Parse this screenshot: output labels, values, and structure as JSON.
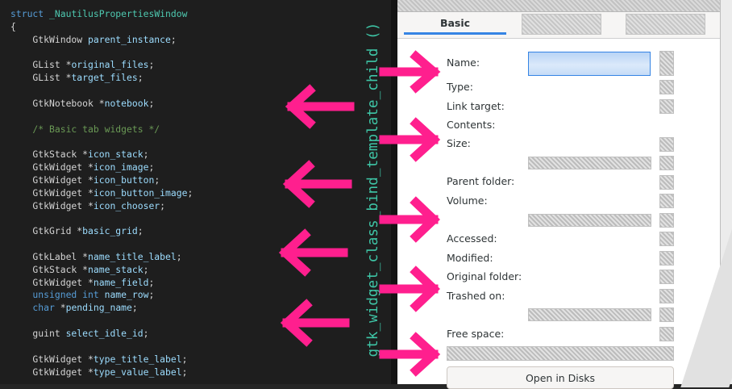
{
  "code": {
    "lines": [
      {
        "parts": [
          {
            "t": "struct ",
            "c": "kw"
          },
          {
            "t": "_NautilusPropertiesWindow",
            "c": "str"
          }
        ]
      },
      {
        "parts": [
          {
            "t": "{",
            "c": "ty"
          }
        ]
      },
      {
        "parts": [
          {
            "t": "    GtkWindow ",
            "c": "ty"
          },
          {
            "t": "parent_instance",
            "c": "id"
          },
          {
            "t": ";",
            "c": "ty"
          }
        ]
      },
      {
        "parts": []
      },
      {
        "parts": [
          {
            "t": "    GList *",
            "c": "ty"
          },
          {
            "t": "original_files",
            "c": "id"
          },
          {
            "t": ";",
            "c": "ty"
          }
        ]
      },
      {
        "parts": [
          {
            "t": "    GList *",
            "c": "ty"
          },
          {
            "t": "target_files",
            "c": "id"
          },
          {
            "t": ";",
            "c": "ty"
          }
        ]
      },
      {
        "parts": []
      },
      {
        "parts": [
          {
            "t": "    GtkNotebook *",
            "c": "ty"
          },
          {
            "t": "notebook",
            "c": "id"
          },
          {
            "t": ";",
            "c": "ty"
          }
        ]
      },
      {
        "parts": []
      },
      {
        "parts": [
          {
            "t": "    /* Basic tab widgets */",
            "c": "cm"
          }
        ]
      },
      {
        "parts": []
      },
      {
        "parts": [
          {
            "t": "    GtkStack *",
            "c": "ty"
          },
          {
            "t": "icon_stack",
            "c": "id"
          },
          {
            "t": ";",
            "c": "ty"
          }
        ]
      },
      {
        "parts": [
          {
            "t": "    GtkWidget *",
            "c": "ty"
          },
          {
            "t": "icon_image",
            "c": "id"
          },
          {
            "t": ";",
            "c": "ty"
          }
        ]
      },
      {
        "parts": [
          {
            "t": "    GtkWidget *",
            "c": "ty"
          },
          {
            "t": "icon_button",
            "c": "id"
          },
          {
            "t": ";",
            "c": "ty"
          }
        ]
      },
      {
        "parts": [
          {
            "t": "    GtkWidget *",
            "c": "ty"
          },
          {
            "t": "icon_button_image",
            "c": "id"
          },
          {
            "t": ";",
            "c": "ty"
          }
        ]
      },
      {
        "parts": [
          {
            "t": "    GtkWidget *",
            "c": "ty"
          },
          {
            "t": "icon_chooser",
            "c": "id"
          },
          {
            "t": ";",
            "c": "ty"
          }
        ]
      },
      {
        "parts": []
      },
      {
        "parts": [
          {
            "t": "    GtkGrid *",
            "c": "ty"
          },
          {
            "t": "basic_grid",
            "c": "id"
          },
          {
            "t": ";",
            "c": "ty"
          }
        ]
      },
      {
        "parts": []
      },
      {
        "parts": [
          {
            "t": "    GtkLabel *",
            "c": "ty"
          },
          {
            "t": "name_title_label",
            "c": "id"
          },
          {
            "t": ";",
            "c": "ty"
          }
        ]
      },
      {
        "parts": [
          {
            "t": "    GtkStack *",
            "c": "ty"
          },
          {
            "t": "name_stack",
            "c": "id"
          },
          {
            "t": ";",
            "c": "ty"
          }
        ]
      },
      {
        "parts": [
          {
            "t": "    GtkWidget *",
            "c": "ty"
          },
          {
            "t": "name_field",
            "c": "id"
          },
          {
            "t": ";",
            "c": "ty"
          }
        ]
      },
      {
        "parts": [
          {
            "t": "    unsigned int ",
            "c": "kw"
          },
          {
            "t": "name_row",
            "c": "id"
          },
          {
            "t": ";",
            "c": "ty"
          }
        ]
      },
      {
        "parts": [
          {
            "t": "    char ",
            "c": "kw"
          },
          {
            "t": "*",
            "c": "ty"
          },
          {
            "t": "pending_name",
            "c": "id"
          },
          {
            "t": ";",
            "c": "ty"
          }
        ]
      },
      {
        "parts": []
      },
      {
        "parts": [
          {
            "t": "    guint ",
            "c": "ty"
          },
          {
            "t": "select_idle_id",
            "c": "id"
          },
          {
            "t": ";",
            "c": "ty"
          }
        ]
      },
      {
        "parts": []
      },
      {
        "parts": [
          {
            "t": "    GtkWidget *",
            "c": "ty"
          },
          {
            "t": "type_title_label",
            "c": "id"
          },
          {
            "t": ";",
            "c": "ty"
          }
        ]
      },
      {
        "parts": [
          {
            "t": "    GtkWidget *",
            "c": "ty"
          },
          {
            "t": "type_value_label",
            "c": "id"
          },
          {
            "t": ";",
            "c": "ty"
          }
        ]
      }
    ]
  },
  "annotation": {
    "text": "gtk_widget_class_bind_template_child ()"
  },
  "properties": {
    "tabs": [
      {
        "label": "Basic"
      }
    ],
    "labels": {
      "name": "Name:",
      "type": "Type:",
      "link_target": "Link target:",
      "contents": "Contents:",
      "size": "Size:",
      "parent_folder": "Parent folder:",
      "volume": "Volume:",
      "accessed": "Accessed:",
      "modified": "Modified:",
      "original_folder": "Original folder:",
      "trashed_on": "Trashed on:",
      "free_space": "Free space:"
    },
    "open_in_disks_label": "Open in Disks"
  },
  "colors": {
    "arrow": "#ff1f8e",
    "annotation": "#3ec5a6",
    "accent": "#3584e4"
  }
}
